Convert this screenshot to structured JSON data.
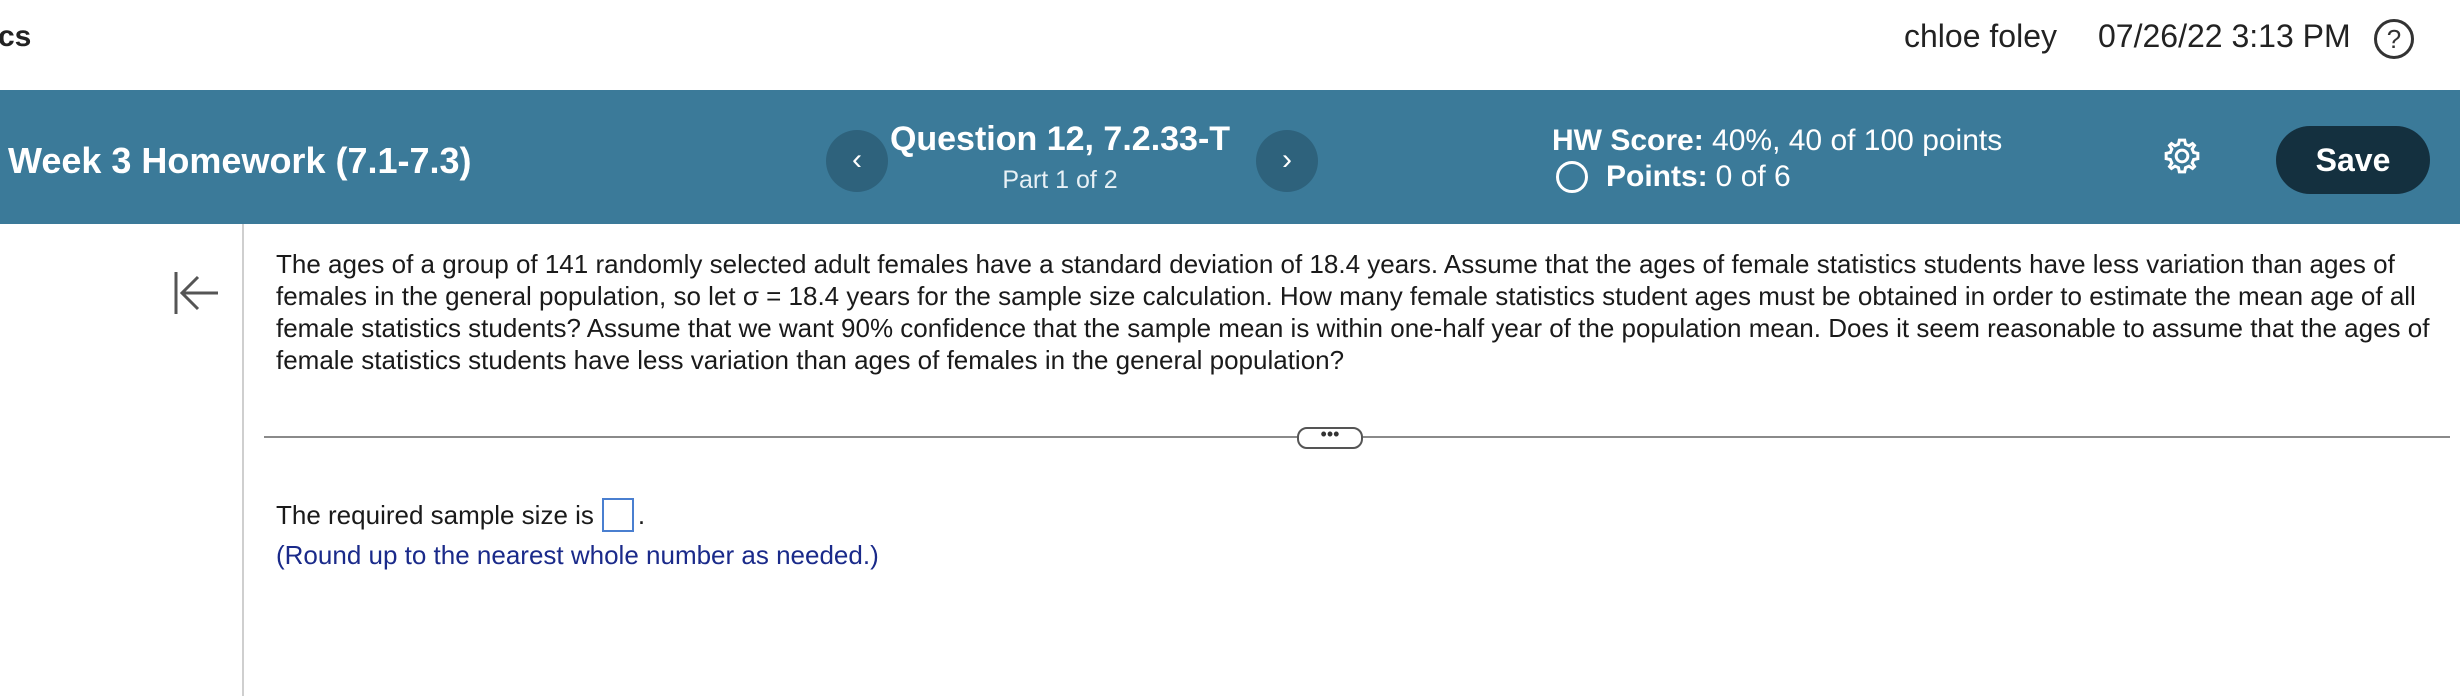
{
  "topbar": {
    "brand": "cs",
    "user_name": "chloe foley",
    "datetime": "07/26/22 3:13 PM",
    "help_symbol": "?"
  },
  "header": {
    "assignment_title": "Week 3 Homework (7.1-7.3)",
    "prev_symbol": "‹",
    "next_symbol": "›",
    "question_title": "Question 12, 7.2.33-T",
    "question_part": "Part 1 of 2",
    "hw_score_label": "HW Score:",
    "hw_score_value": "40%, 40 of 100 points",
    "points_label": "Points:",
    "points_value": "0 of 6",
    "save_label": "Save",
    "icons": {
      "settings": "gear-icon",
      "points_status": "circle-icon"
    },
    "colors": {
      "header_bg": "#3b7a99",
      "save_bg": "#14303f"
    }
  },
  "content": {
    "question_text": "The ages of a group of 141 randomly selected adult females have a standard deviation of 18.4 years. Assume that the ages of female statistics students have less variation than ages of females in the general population, so let σ = 18.4 years for the sample size calculation. How many female statistics student ages must be obtained in order to estimate the mean age of all female statistics students? Assume that we want 90% confidence that the sample mean is within one-half year of the population mean. Does it seem reasonable to assume that the ages of female statistics students have less variation than ages of females in the general population?",
    "more_symbol": "•••",
    "answer_prefix": "The required sample size is",
    "answer_value": "",
    "answer_suffix": ".",
    "hint": "(Round up to the nearest whole number as needed.)"
  }
}
